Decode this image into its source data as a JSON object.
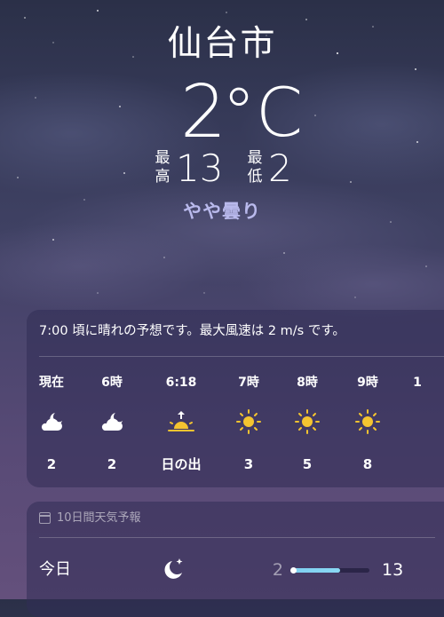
{
  "location": {
    "city": "仙台市"
  },
  "current": {
    "temperature": "2",
    "unit": "°C",
    "high_label": "最高",
    "high": "13",
    "low_label": "最低",
    "low": "2",
    "condition": "やや曇り"
  },
  "hourly": {
    "summary": "7:00 頃に晴れの予想です。最大風速は 2 m/s です。",
    "items": [
      {
        "time": "現在",
        "icon": "partly-cloudy-night-icon",
        "value": "2"
      },
      {
        "time": "6時",
        "icon": "partly-cloudy-night-icon",
        "value": "2"
      },
      {
        "time": "6:18",
        "icon": "sunrise-icon",
        "value": "日の出"
      },
      {
        "time": "7時",
        "icon": "sun-icon",
        "value": "3"
      },
      {
        "time": "8時",
        "icon": "sun-icon",
        "value": "5"
      },
      {
        "time": "9時",
        "icon": "sun-icon",
        "value": "8"
      },
      {
        "time": "1",
        "icon": "",
        "value": ""
      }
    ]
  },
  "daily": {
    "header": "10日間天気予報",
    "header_icon": "calendar-icon",
    "days": [
      {
        "day": "今日",
        "icon": "moon-stars-icon",
        "low": "2",
        "high": "13",
        "range_fraction": 0.62
      }
    ]
  },
  "colors": {
    "condition_text": "#b9b9ec",
    "sun": "#f4c430",
    "temp_bar": "#8ad8f4"
  }
}
